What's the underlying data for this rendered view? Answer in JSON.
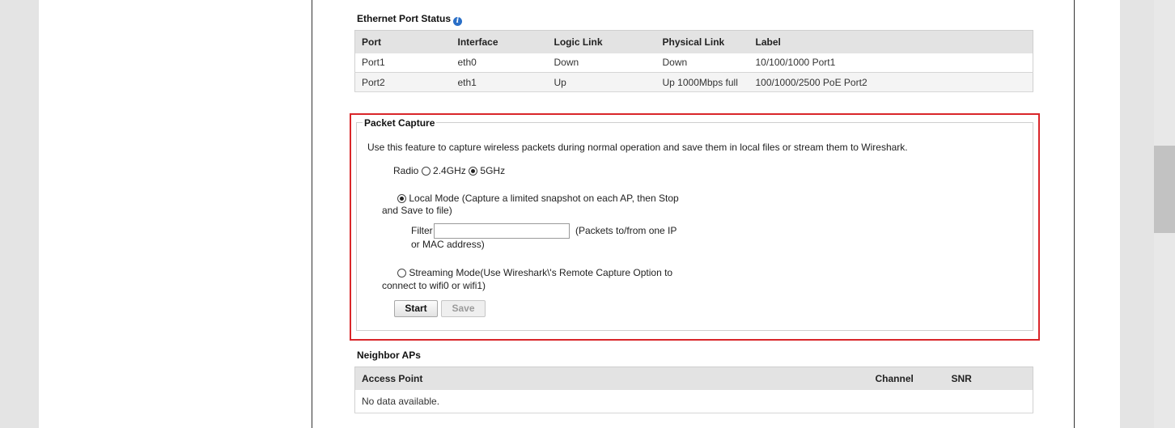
{
  "ethernet": {
    "title": "Ethernet Port Status",
    "columns": [
      "Port",
      "Interface",
      "Logic Link",
      "Physical Link",
      "Label"
    ],
    "rows": [
      [
        "Port1",
        "eth0",
        "Down",
        "Down",
        "10/100/1000 Port1"
      ],
      [
        "Port2",
        "eth1",
        "Up",
        "Up 1000Mbps full",
        "100/1000/2500 PoE Port2"
      ]
    ]
  },
  "packet_capture": {
    "legend": "Packet Capture",
    "description": "Use this feature to capture wireless packets during normal operation and save them in local files or stream them to Wireshark.",
    "radio_label": "Radio",
    "radio_options": [
      "2.4GHz",
      "5GHz"
    ],
    "radio_selected": "5GHz",
    "local_mode_line1": "Local Mode (Capture a limited snapshot on each AP, then Stop",
    "local_mode_line2": "and Save to file)",
    "filter_label": "Filter",
    "filter_value": "",
    "filter_hint_line1": "(Packets to/from one IP",
    "filter_hint_line2": "or MAC address)",
    "streaming_line1": "Streaming Mode(Use Wireshark\\'s Remote Capture Option to",
    "streaming_line2": "connect to wifi0 or wifi1)",
    "mode_selected": "local",
    "start_label": "Start",
    "save_label": "Save"
  },
  "neighbors": {
    "title": "Neighbor APs",
    "columns": [
      "Access Point",
      "Channel",
      "SNR"
    ],
    "empty_text": "No data available."
  }
}
